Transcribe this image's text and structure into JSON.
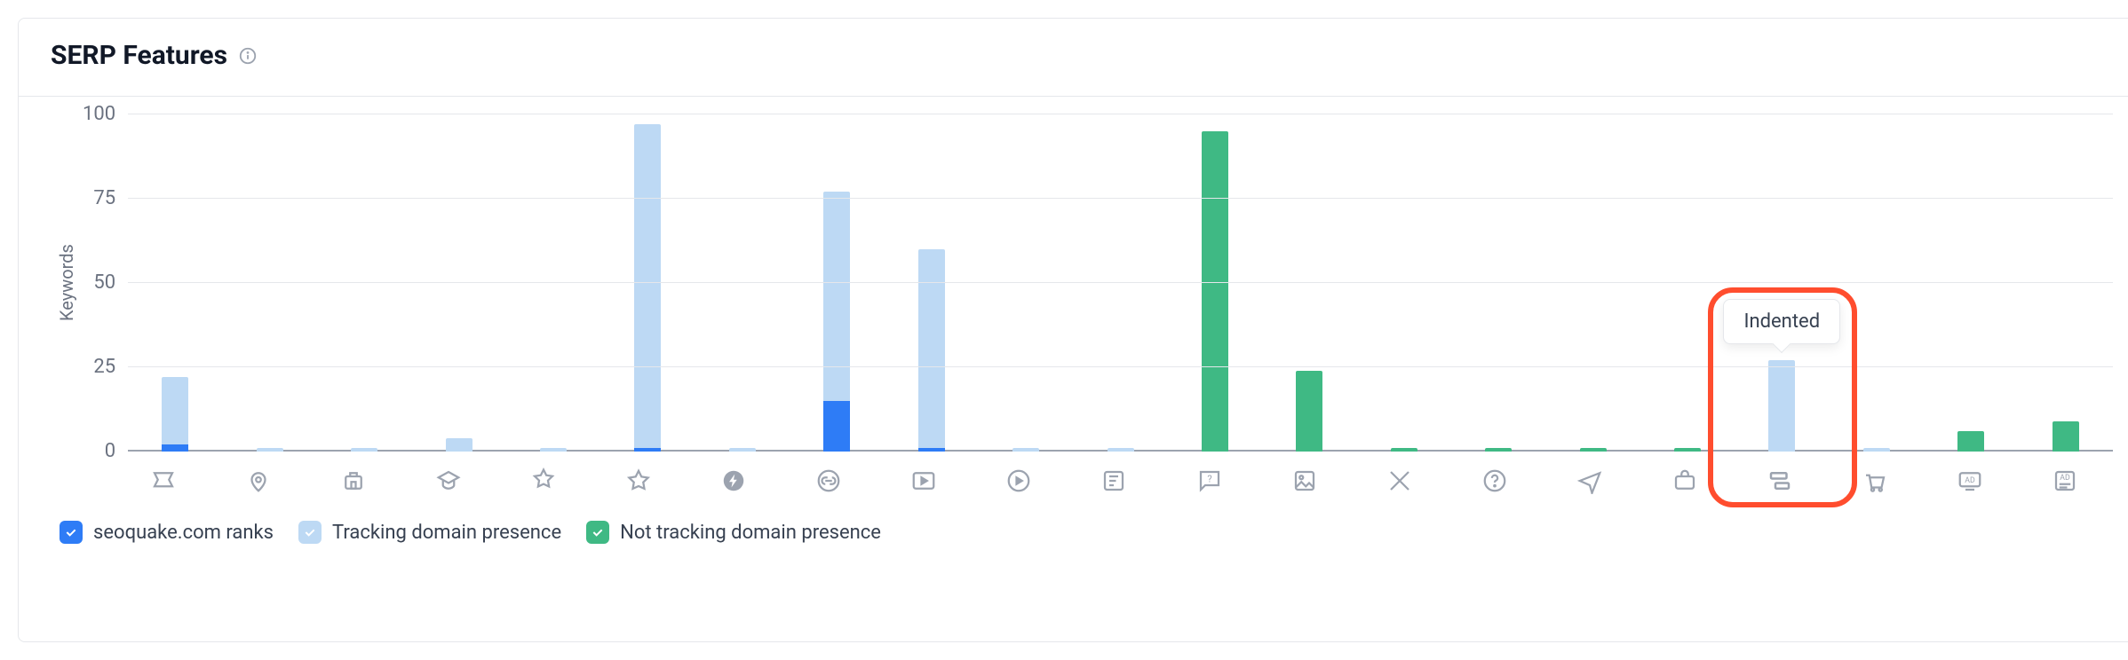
{
  "title": "SERP Features",
  "ylabel": "Keywords",
  "yticks": [
    "100",
    "75",
    "50",
    "25",
    "0"
  ],
  "legend": {
    "ranks": "seoquake.com ranks",
    "tracking": "Tracking domain presence",
    "nontracking": "Not tracking domain presence"
  },
  "tooltip": "Indented",
  "chart_data": {
    "type": "bar",
    "ylabel": "Keywords",
    "ylim": [
      0,
      100
    ],
    "stacked": true,
    "categories": [
      "featured-snippet",
      "local-pack",
      "local-teaser",
      "knowledge-panel",
      "instant-answer",
      "reviews",
      "amp",
      "sitelinks",
      "video",
      "video-carousel",
      "news",
      "faq",
      "image",
      "twitter",
      "people-also-ask",
      "flights",
      "jobs",
      "indented",
      "shopping-ads",
      "ads-top",
      "ads-bottom"
    ],
    "series": [
      {
        "name": "seoquake.com ranks",
        "key": "ranks",
        "color": "#2e7cf6",
        "values": [
          2,
          0,
          0,
          0,
          0,
          1,
          0,
          15,
          1,
          0,
          0,
          0,
          0,
          0,
          0,
          0,
          0,
          0,
          0,
          0,
          0
        ]
      },
      {
        "name": "Tracking domain presence",
        "key": "tracking",
        "color": "#bdd9f4",
        "values": [
          20,
          1,
          1,
          4,
          1,
          96,
          1,
          62,
          59,
          1,
          1,
          0,
          0,
          0,
          0,
          0,
          0,
          27,
          1,
          0,
          0
        ]
      },
      {
        "name": "Not tracking domain presence",
        "key": "nontracking",
        "color": "#3fb984",
        "values": [
          0,
          0,
          0,
          0,
          0,
          0,
          0,
          0,
          0,
          0,
          0,
          95,
          24,
          1,
          1,
          1,
          1,
          0,
          0,
          6,
          9
        ]
      }
    ],
    "tooltip_category_index": 17,
    "tooltip_label": "Indented"
  }
}
